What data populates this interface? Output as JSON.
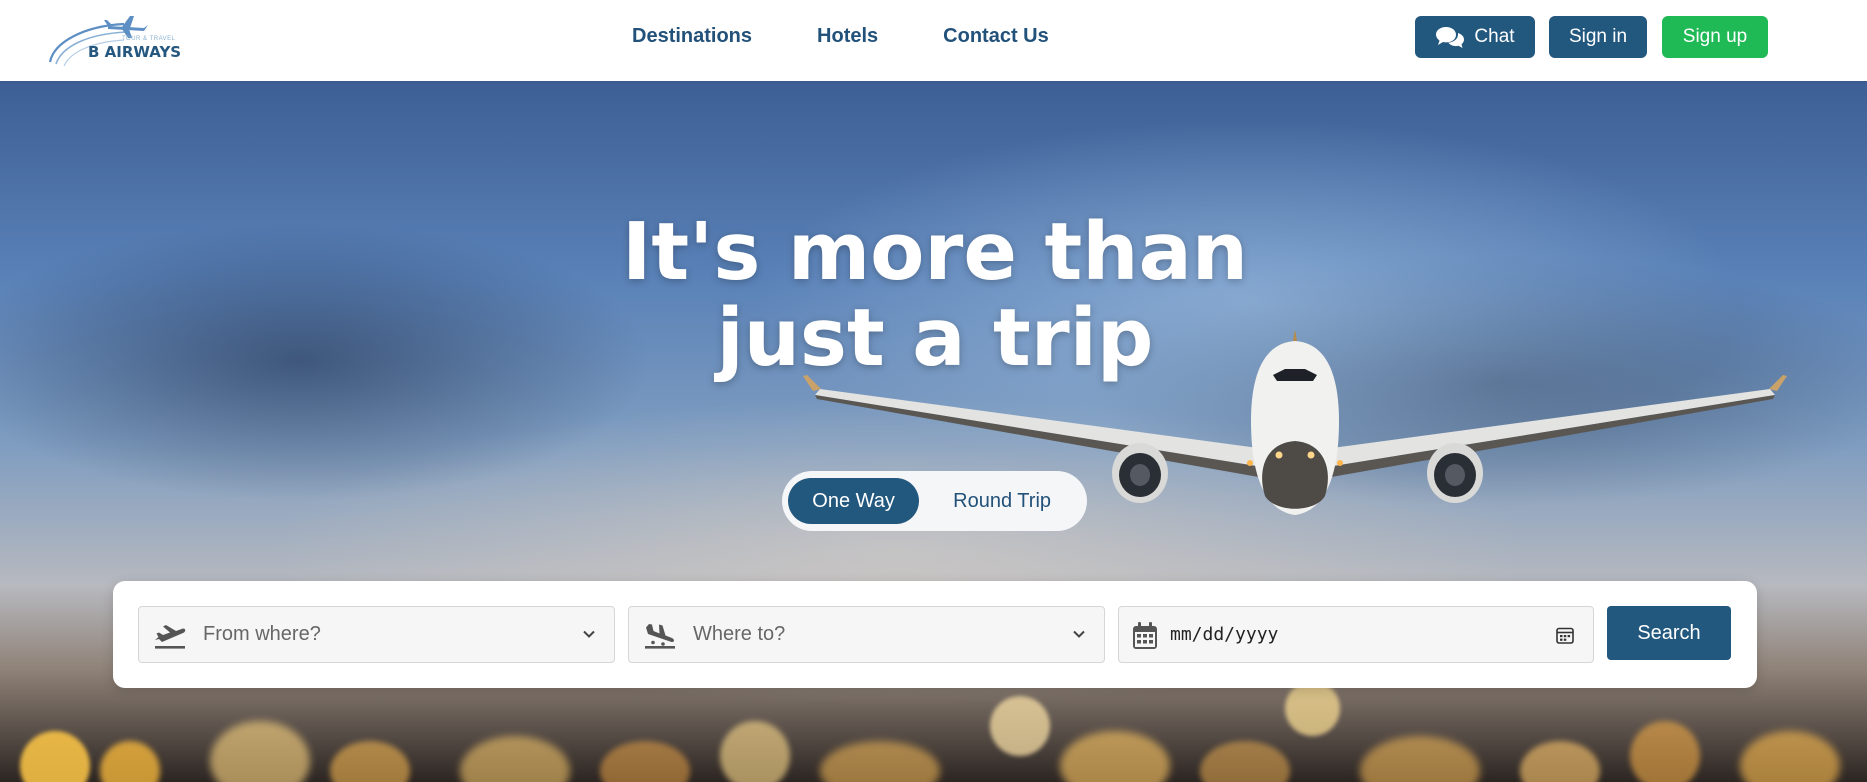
{
  "header": {
    "logo": {
      "brand": "B AIRWAYS",
      "tagline": "TOUR & TRAVEL"
    },
    "nav": [
      {
        "label": "Destinations"
      },
      {
        "label": "Hotels"
      },
      {
        "label": "Contact Us"
      }
    ],
    "actions": {
      "chat_label": "Chat",
      "signin_label": "Sign in",
      "signup_label": "Sign up"
    }
  },
  "hero": {
    "title_line1": "It's more than",
    "title_line2": "just a trip"
  },
  "trip_type": {
    "options": [
      "One Way",
      "Round Trip"
    ],
    "selected": "One Way"
  },
  "search": {
    "from_placeholder": "From where?",
    "to_placeholder": "Where to?",
    "date_placeholder": "mm/dd/yyyy",
    "button_label": "Search"
  },
  "icons": {
    "chat": "chat-bubbles-icon",
    "from": "plane-takeoff-icon",
    "to": "plane-landing-icon",
    "date": "calendar-icon",
    "dropdown": "chevron-down-icon"
  },
  "colors": {
    "primary": "#22577e",
    "success": "#1fb956",
    "nav_text": "#22517a"
  }
}
